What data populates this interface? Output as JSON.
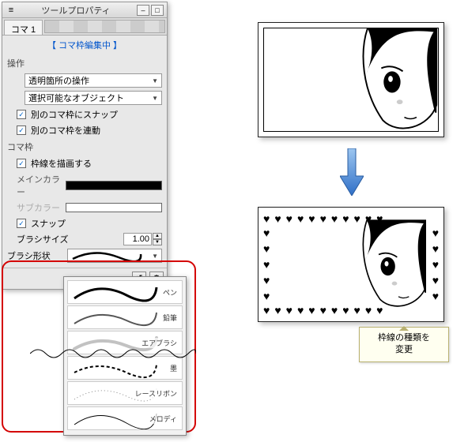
{
  "panel": {
    "title": "ツールプロパティ",
    "tab": "コマ 1",
    "status": "【 コマ枠編集中 】",
    "section_operation": "操作",
    "select_transparent": "透明箇所の操作",
    "select_selectable": "選択可能なオブジェクト",
    "chk_snap_other": "別のコマ枠にスナップ",
    "chk_link_other": "別のコマ枠を連動",
    "section_frame": "コマ枠",
    "chk_draw_border": "枠線を描画する",
    "label_main_color": "メインカラー",
    "label_sub_color": "サブカラー",
    "chk_snap": "スナップ",
    "label_brush_size": "ブラシサイズ",
    "brush_size_value": "1.00",
    "label_brush_shape": "ブラシ形状"
  },
  "brush_shapes": [
    {
      "name": "ペン"
    },
    {
      "name": "鉛筆"
    },
    {
      "name": "エアブラシ"
    },
    {
      "name": "墨"
    },
    {
      "name": "レースリボン"
    },
    {
      "name": "メロディ"
    }
  ],
  "note": {
    "line1": "枠線の種類を",
    "line2": "変更"
  }
}
